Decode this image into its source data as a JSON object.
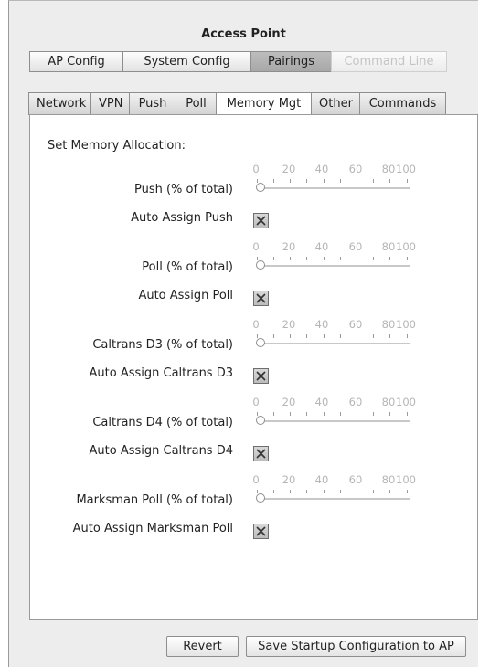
{
  "window": {
    "title": "Access Point"
  },
  "top_tabs": [
    {
      "label": "AP Config",
      "state": "normal"
    },
    {
      "label": "System Config",
      "state": "normal"
    },
    {
      "label": "Pairings",
      "state": "selected"
    },
    {
      "label": "Command Line",
      "state": "disabled"
    }
  ],
  "inner_tabs": [
    {
      "label": "Network",
      "selected": false
    },
    {
      "label": "VPN",
      "selected": false
    },
    {
      "label": "Push",
      "selected": false
    },
    {
      "label": "Poll",
      "selected": false
    },
    {
      "label": "Memory Mgt",
      "selected": true
    },
    {
      "label": "Other",
      "selected": false
    },
    {
      "label": "Commands",
      "selected": false
    }
  ],
  "panel": {
    "section_label": "Set Memory Allocation:",
    "slider_ticks": [
      "0",
      "20",
      "40",
      "60",
      "80",
      "100"
    ],
    "rows": [
      {
        "slider_label": "Push (% of total)",
        "slider_value_percent": 0,
        "checkbox_label": "Auto Assign Push",
        "checked": true
      },
      {
        "slider_label": "Poll (% of total)",
        "slider_value_percent": 0,
        "checkbox_label": "Auto Assign Poll",
        "checked": true
      },
      {
        "slider_label": "Caltrans D3 (% of total)",
        "slider_value_percent": 0,
        "checkbox_label": "Auto Assign Caltrans D3",
        "checked": true
      },
      {
        "slider_label": "Caltrans D4 (% of total)",
        "slider_value_percent": 0,
        "checkbox_label": "Auto Assign Caltrans D4",
        "checked": true
      },
      {
        "slider_label": "Marksman Poll (% of total)",
        "slider_value_percent": 0,
        "checkbox_label": "Auto Assign Marksman Poll",
        "checked": true
      }
    ]
  },
  "footer": {
    "revert_label": "Revert",
    "save_label": "Save Startup Configuration to AP"
  }
}
